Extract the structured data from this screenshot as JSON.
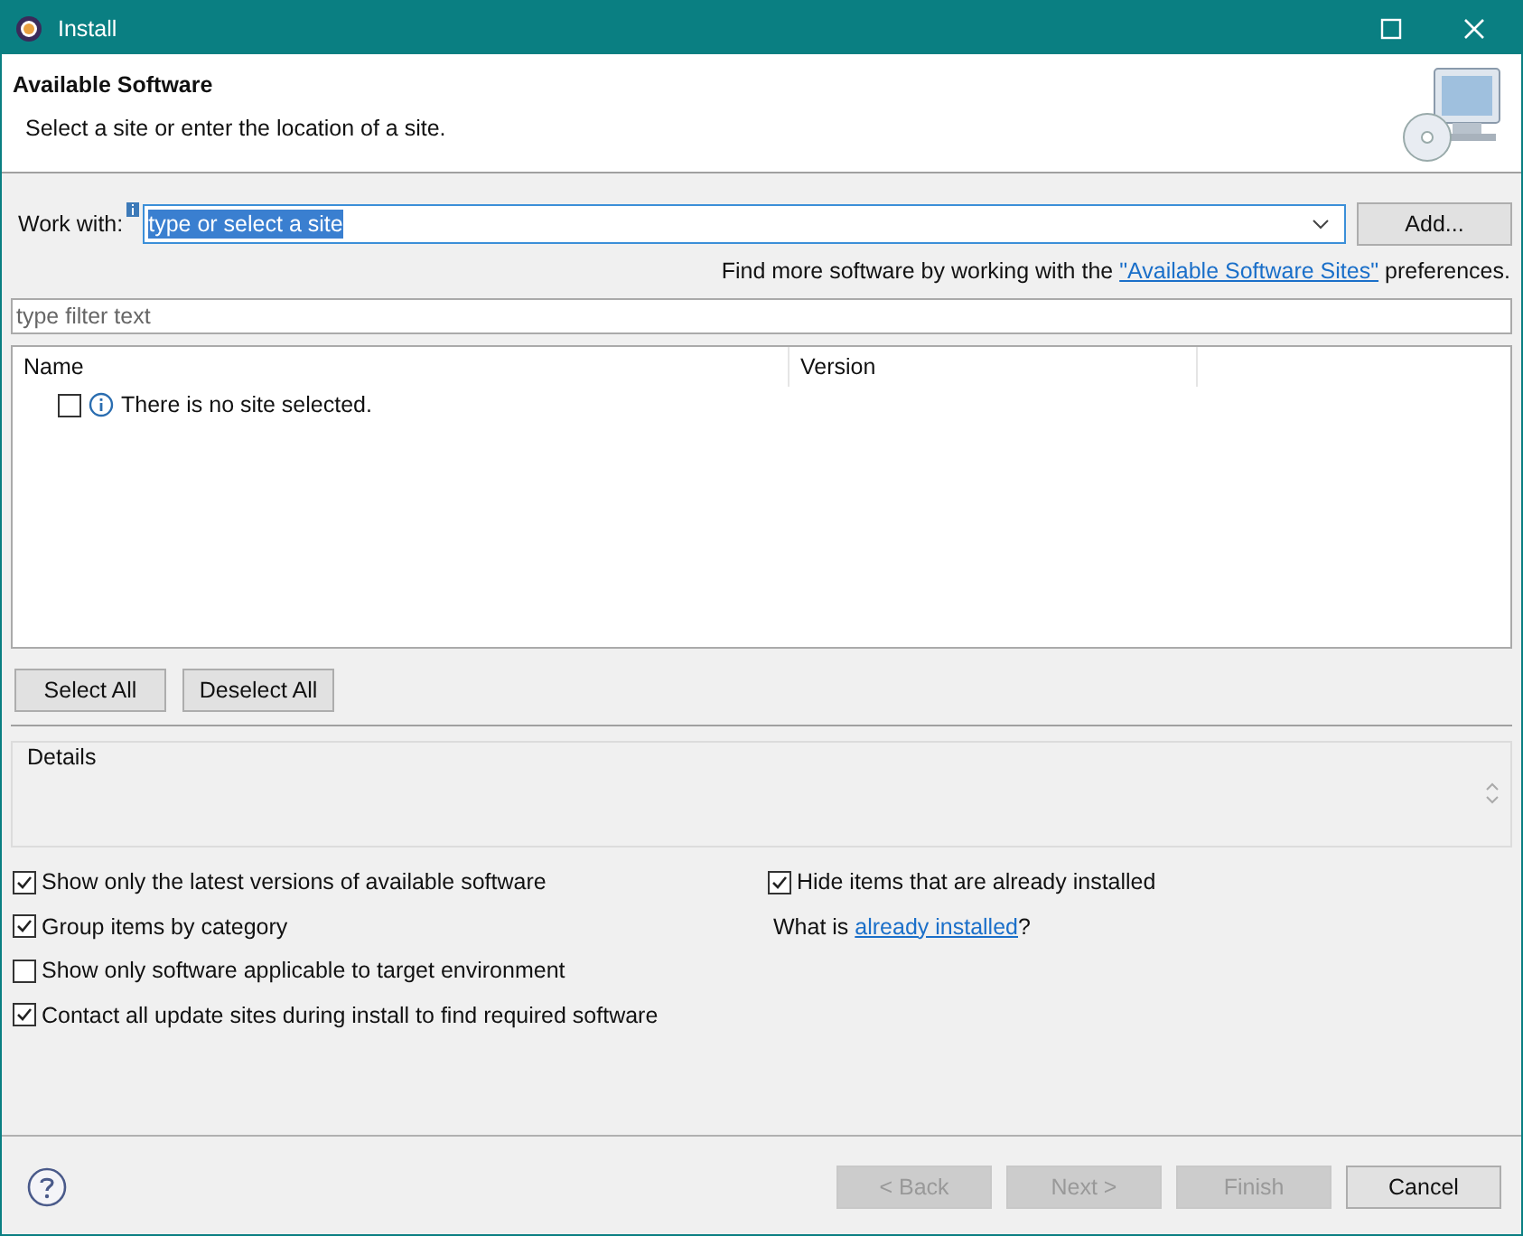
{
  "window": {
    "title": "Install"
  },
  "header": {
    "title": "Available Software",
    "description": "Select a site or enter the location of a site."
  },
  "work_with": {
    "label": "Work with:",
    "value": "type or select a site",
    "text_selected": true,
    "add_button": "Add..."
  },
  "find_more": {
    "before": "Find more software by working with the ",
    "link": "\"Available Software Sites\"",
    "after": " preferences."
  },
  "filter": {
    "placeholder": "type filter text"
  },
  "table": {
    "columns": [
      "Name",
      "Version"
    ],
    "rows": [
      {
        "checked": false,
        "text": "There is no site selected."
      }
    ]
  },
  "selection_buttons": [
    "Select All",
    "Deselect All"
  ],
  "details": {
    "label": "Details"
  },
  "left_options": [
    {
      "label": "Show only the latest versions of available software",
      "checked": true
    },
    {
      "label": "Group items by category",
      "checked": true
    },
    {
      "label": "Show only software applicable to target environment",
      "checked": false
    },
    {
      "label": "Contact all update sites during install to find required software",
      "checked": true
    }
  ],
  "right_option": {
    "label": "Hide items that are already installed",
    "checked": true
  },
  "installed_note": {
    "before": "What is ",
    "link": "already installed",
    "after": "?"
  },
  "footer_buttons": [
    {
      "label": "< Back",
      "disabled": true
    },
    {
      "label": "Next >",
      "disabled": true
    },
    {
      "label": "Finish",
      "disabled": true
    },
    {
      "label": "Cancel",
      "disabled": false
    }
  ]
}
